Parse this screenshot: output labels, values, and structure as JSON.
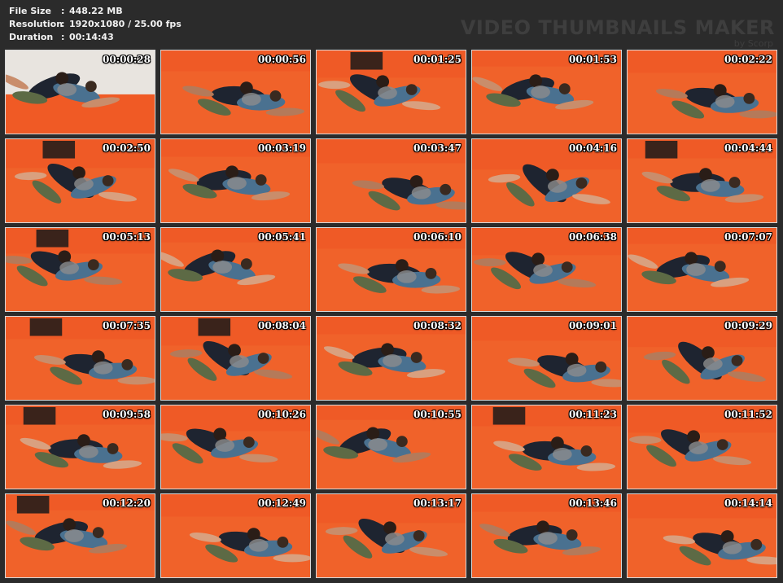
{
  "info": {
    "file_size_label": "File Size",
    "file_size_value": "448.22 MB",
    "resolution_label": "Resolution",
    "resolution_value": "1920x1080 / 25.00 fps",
    "duration_label": "Duration",
    "duration_value": "00:14:43",
    "separator": ":"
  },
  "watermark": {
    "title": "VIDEO THUMBNAILS MAKER",
    "byline": "by Scorp"
  },
  "colors": {
    "mat": "#f05a25",
    "background": "#2b2b2b"
  },
  "thumbnails": [
    "00:00:28",
    "00:00:56",
    "00:01:25",
    "00:01:53",
    "00:02:22",
    "00:02:50",
    "00:03:19",
    "00:03:47",
    "00:04:16",
    "00:04:44",
    "00:05:13",
    "00:05:41",
    "00:06:10",
    "00:06:38",
    "00:07:07",
    "00:07:35",
    "00:08:04",
    "00:08:32",
    "00:09:01",
    "00:09:29",
    "00:09:58",
    "00:10:26",
    "00:10:55",
    "00:11:23",
    "00:11:52",
    "00:12:20",
    "00:12:49",
    "00:13:17",
    "00:13:46",
    "00:14:14"
  ]
}
